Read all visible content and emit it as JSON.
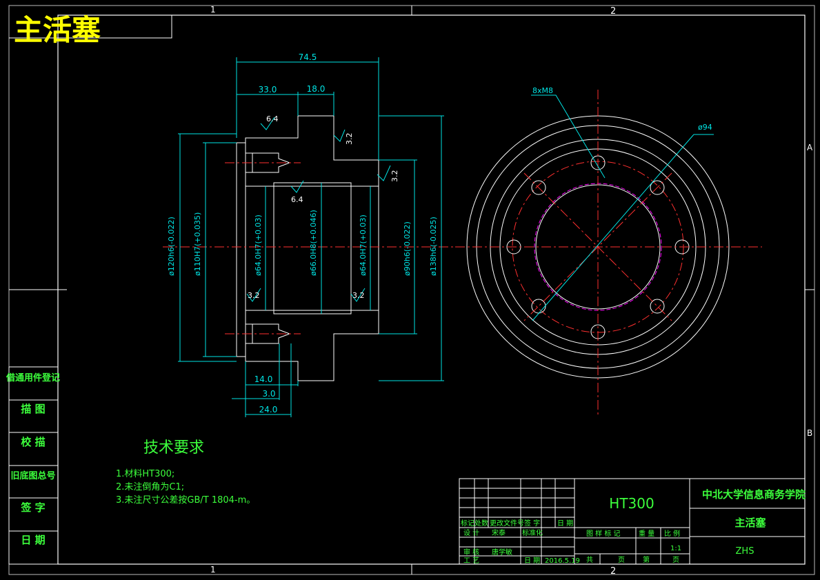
{
  "title": "主活塞",
  "zone_marks": {
    "top_1": "1",
    "top_2": "2",
    "bottom_1": "1",
    "bottom_2": "2",
    "right_a": "A",
    "right_b": "B"
  },
  "left_strip": [
    "借通用件登记",
    "描 图",
    "校 描",
    "旧底图总号",
    "签 字",
    "日 期"
  ],
  "dims": {
    "d74_5": "74.5",
    "d33": "33.0",
    "d18": "18.0",
    "d14": "14.0",
    "d3": "3.0",
    "d24": "24.0",
    "r6_4a": "6.4",
    "r6_4b": "6.4",
    "r3_2a": "3.2",
    "r3_2b": "3.2",
    "r3_2c": "3.2",
    "r3_2d": "3.2",
    "phi120": "ø120h6(-0.022)",
    "phi110": "ø110H7(+0.035)",
    "phi64a": "ø64.0H7(+0.03)",
    "phi66": "ø66.0H8(+0.046)",
    "phi64b": "ø64.0H7(+0.03)",
    "phi90": "ø90h6(-0.022)",
    "phi138": "ø138h6(-0.025)",
    "holes": "8xM8",
    "phi94": "ø94"
  },
  "tech": {
    "heading": "技术要求",
    "items": [
      "1.材料HT300;",
      "2.未注倒角为C1;",
      "3.未注尺寸公差按GB/T 1804-m。"
    ]
  },
  "title_block": {
    "material": "HT300",
    "school": "中北大学信息商务学院",
    "part_name": "主活塞",
    "code": "ZHS",
    "row_labels": [
      "标记",
      "处数",
      "更改文件号",
      "签 字",
      "日 期"
    ],
    "design_label": "设 计",
    "designer": "宋泰",
    "std_label": "标准化",
    "review_label": "审 核",
    "reviewer": "唐学敏",
    "process_label": "工 艺",
    "date_label": "日 期",
    "date": "2016.5.19",
    "stage_label": "图 样 标 记",
    "weight_label": "重 量",
    "scale_label": "比 例",
    "scale": "1:1",
    "total_label": "共",
    "page_label": "页",
    "sheet_label": "第",
    "sheet_page_label": "页"
  }
}
